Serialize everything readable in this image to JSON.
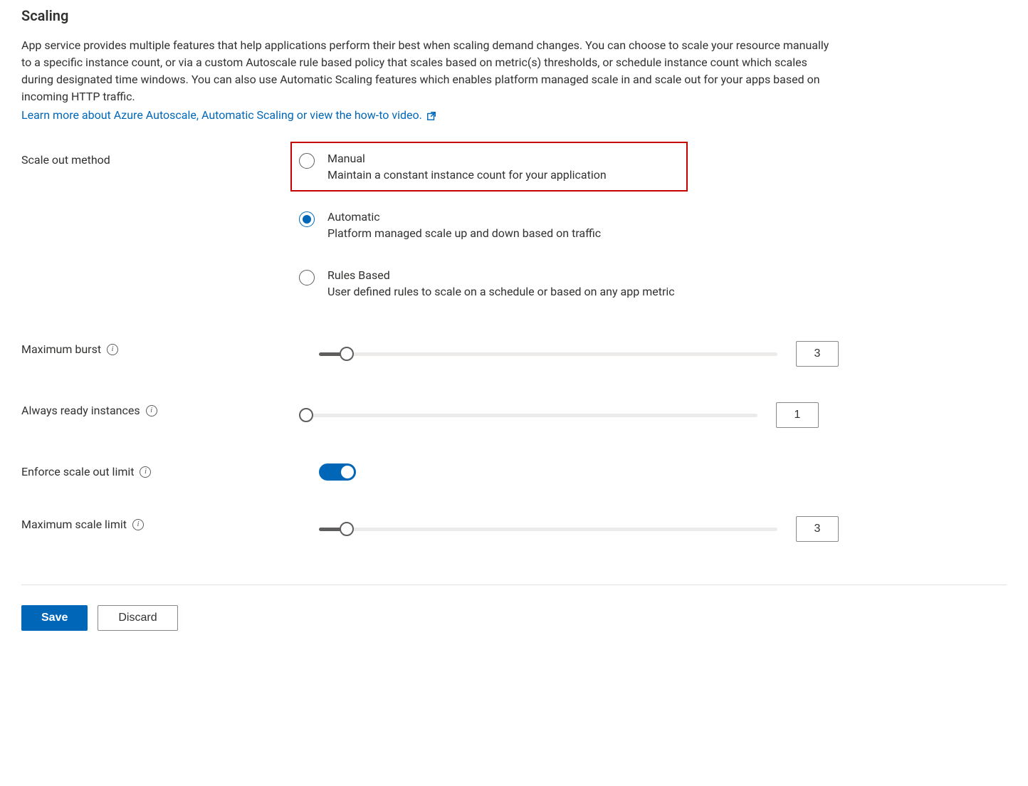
{
  "heading": "Scaling",
  "description": "App service provides multiple features that help applications perform their best when scaling demand changes. You can choose to scale your resource manually to a specific instance count, or via a custom Autoscale rule based policy that scales based on metric(s) thresholds, or schedule instance count which scales during designated time windows. You can also use Automatic Scaling features which enables platform managed scale in and scale out for your apps based on incoming HTTP traffic.",
  "learn_more_link": "Learn more about Azure Autoscale, Automatic Scaling or view the how-to video.",
  "scale_out_method": {
    "label": "Scale out method",
    "options": [
      {
        "title": "Manual",
        "subtitle": "Maintain a constant instance count for your application",
        "selected": false,
        "highlighted": true
      },
      {
        "title": "Automatic",
        "subtitle": "Platform managed scale up and down based on traffic",
        "selected": true,
        "highlighted": false
      },
      {
        "title": "Rules Based",
        "subtitle": "User defined rules to scale on a schedule or based on any app metric",
        "selected": false,
        "highlighted": false
      }
    ]
  },
  "maximum_burst": {
    "label": "Maximum burst",
    "value": "3",
    "fill_percent": 6
  },
  "always_ready": {
    "label": "Always ready instances",
    "value": "1",
    "fill_percent": 0
  },
  "enforce_limit": {
    "label": "Enforce scale out limit",
    "on": true
  },
  "max_scale_limit": {
    "label": "Maximum scale limit",
    "value": "3",
    "fill_percent": 6
  },
  "footer": {
    "save": "Save",
    "discard": "Discard"
  }
}
